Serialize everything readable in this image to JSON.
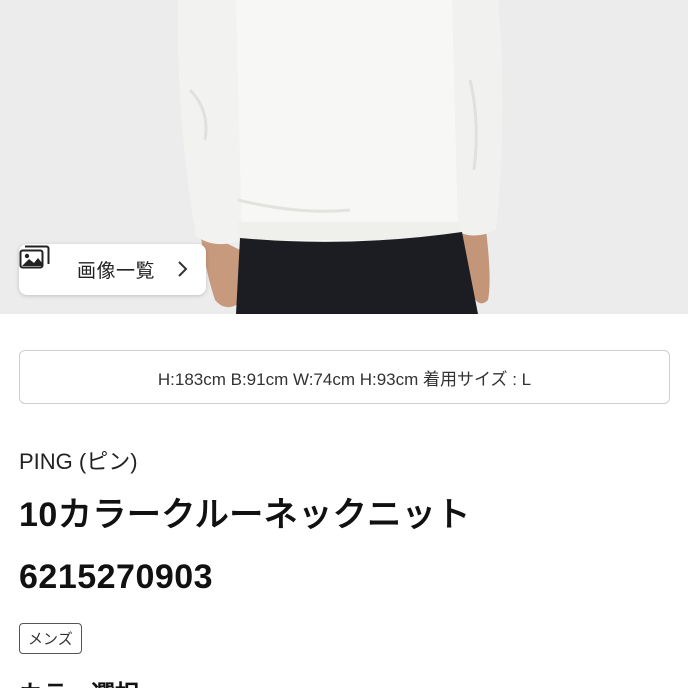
{
  "gallery_button": {
    "label": "画像一覧",
    "icon": "image-gallery-icon",
    "chevron": "chevron-right-icon"
  },
  "model_info": {
    "text": "H:183cm B:91cm W:74cm H:93cm 着用サイズ : L"
  },
  "product": {
    "brand": "PING (ピン)",
    "title": "10カラークルーネックニット 6215270903",
    "gender_tag": "メンズ"
  },
  "section": {
    "heading": "カラー選択"
  }
}
